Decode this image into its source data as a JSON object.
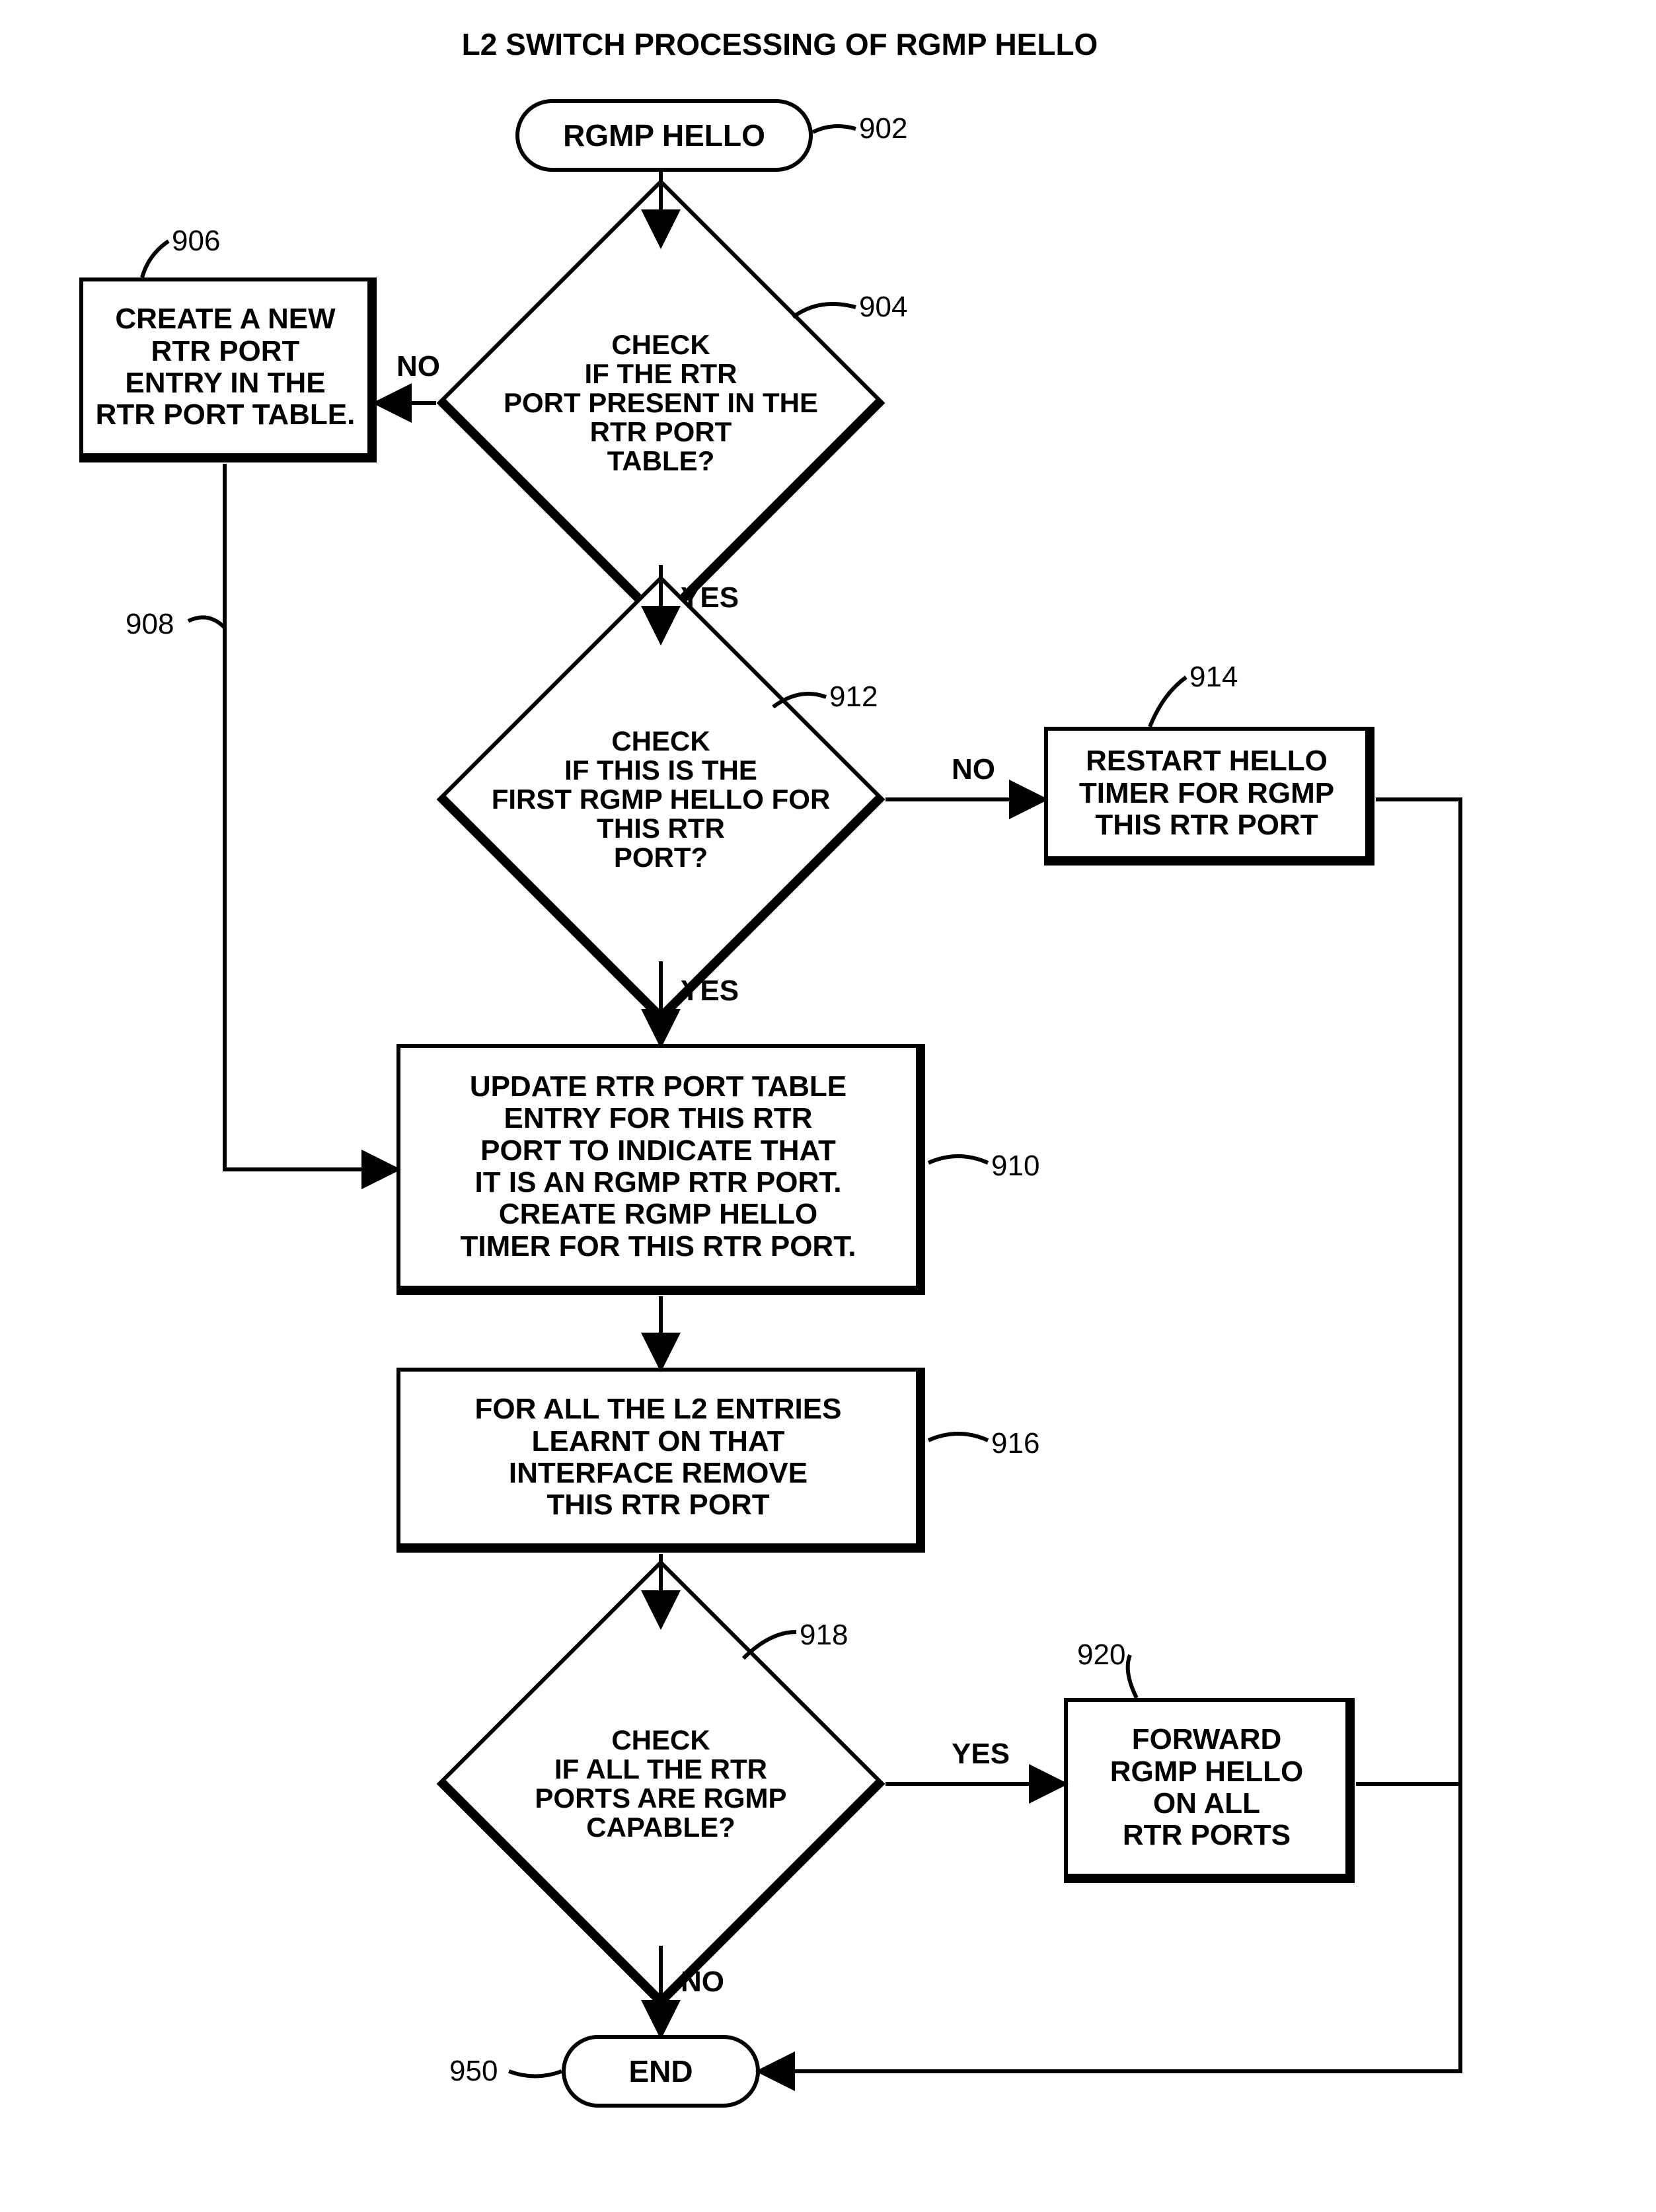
{
  "title": "L2 SWITCH PROCESSING OF RGMP HELLO",
  "nodes": {
    "start": {
      "text": "RGMP HELLO",
      "ref": "902"
    },
    "d904": {
      "text": "CHECK\nIF THE RTR\nPORT PRESENT IN THE\nRTR PORT\nTABLE?",
      "ref": "904"
    },
    "p906": {
      "text": "CREATE A NEW\nRTR PORT\nENTRY IN THE\nRTR PORT TABLE.",
      "ref": "906"
    },
    "arrow908": {
      "ref": "908"
    },
    "d912": {
      "text": "CHECK\nIF THIS IS THE\nFIRST RGMP HELLO FOR\nTHIS RTR\nPORT?",
      "ref": "912"
    },
    "p914": {
      "text": "RESTART HELLO\nTIMER FOR RGMP\nTHIS RTR PORT",
      "ref": "914"
    },
    "p910": {
      "text": "UPDATE RTR PORT TABLE\nENTRY FOR THIS RTR\nPORT TO INDICATE THAT\nIT IS AN RGMP RTR PORT.\nCREATE RGMP HELLO\nTIMER FOR THIS RTR PORT.",
      "ref": "910"
    },
    "p916": {
      "text": "FOR ALL THE L2 ENTRIES\nLEARNT ON THAT\nINTERFACE REMOVE\nTHIS RTR PORT",
      "ref": "916"
    },
    "d918": {
      "text": "CHECK\nIF ALL THE RTR\nPORTS ARE RGMP\nCAPABLE?",
      "ref": "918"
    },
    "p920": {
      "text": "FORWARD\nRGMP HELLO\nON ALL\nRTR PORTS",
      "ref": "920"
    },
    "end": {
      "text": "END",
      "ref": "950"
    }
  },
  "edges": {
    "yes": "YES",
    "no": "NO"
  }
}
